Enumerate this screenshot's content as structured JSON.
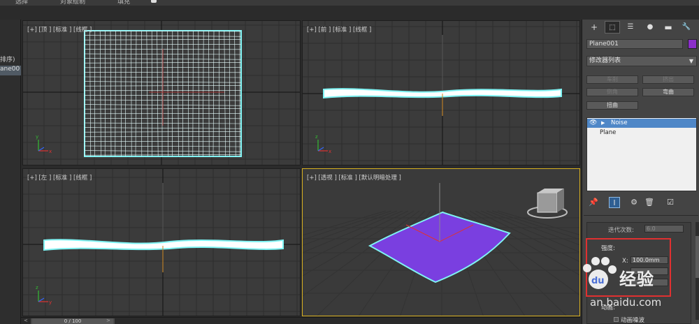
{
  "menu": {
    "items": [
      "选择",
      "对象绘制",
      "填充"
    ]
  },
  "scene_explorer": {
    "header_fragment": "排序)",
    "selected_fragment": "ane00"
  },
  "viewports": {
    "top": {
      "label": "[+] [顶 ] [标准 ] [线框 ]"
    },
    "front": {
      "label": "[+] [前 ] [标准 ] [线框 ]"
    },
    "left": {
      "label": "[+] [左 ] [标准 ] [线框 ]"
    },
    "perspective": {
      "label": "[+] [透视 ] [标准 ] [默认明暗处理 ]"
    }
  },
  "timeline": {
    "position": "0 / 100",
    "prev_arrow": "<",
    "next_arrow": ">"
  },
  "command_panel": {
    "tabs": [
      {
        "icon": "create-icon",
        "glyph": "+"
      },
      {
        "icon": "modify-icon",
        "glyph": "⬚"
      },
      {
        "icon": "hierarchy-icon",
        "glyph": "☰"
      },
      {
        "icon": "motion-icon",
        "glyph": "●"
      },
      {
        "icon": "display-icon",
        "glyph": "▬"
      },
      {
        "icon": "utilities-icon",
        "glyph": "🔧"
      }
    ],
    "object_name": "Plane001",
    "object_color": "#8b2fc9",
    "modifier_list_label": "修改器列表",
    "modifier_buttons": [
      {
        "label": "车削",
        "enabled": false
      },
      {
        "label": "挤出",
        "enabled": false
      },
      {
        "label": "倒角",
        "enabled": false
      },
      {
        "label": "弯曲",
        "enabled": true
      },
      {
        "label": "扭曲",
        "enabled": true
      }
    ],
    "stack": [
      {
        "label": "Noise",
        "selected": true
      },
      {
        "label": "Plane",
        "selected": false
      }
    ],
    "iterations_label": "迭代次数:",
    "iterations_value": "6.0",
    "strength_label": "强度:",
    "strength_x_label": "X:",
    "strength_x_value": "100.0mm",
    "anim_label": "动画:",
    "anim_noise_label": "动画噪波"
  },
  "watermark": {
    "brand": "经验",
    "url": "jingyan.baidu.com",
    "url_visible": "an.baidu.com"
  },
  "colors": {
    "selection_cyan": "#7ff3f3",
    "active_border": "#d8b020",
    "surface_purple": "#7a3fe0",
    "highlight_box": "#e03030"
  }
}
